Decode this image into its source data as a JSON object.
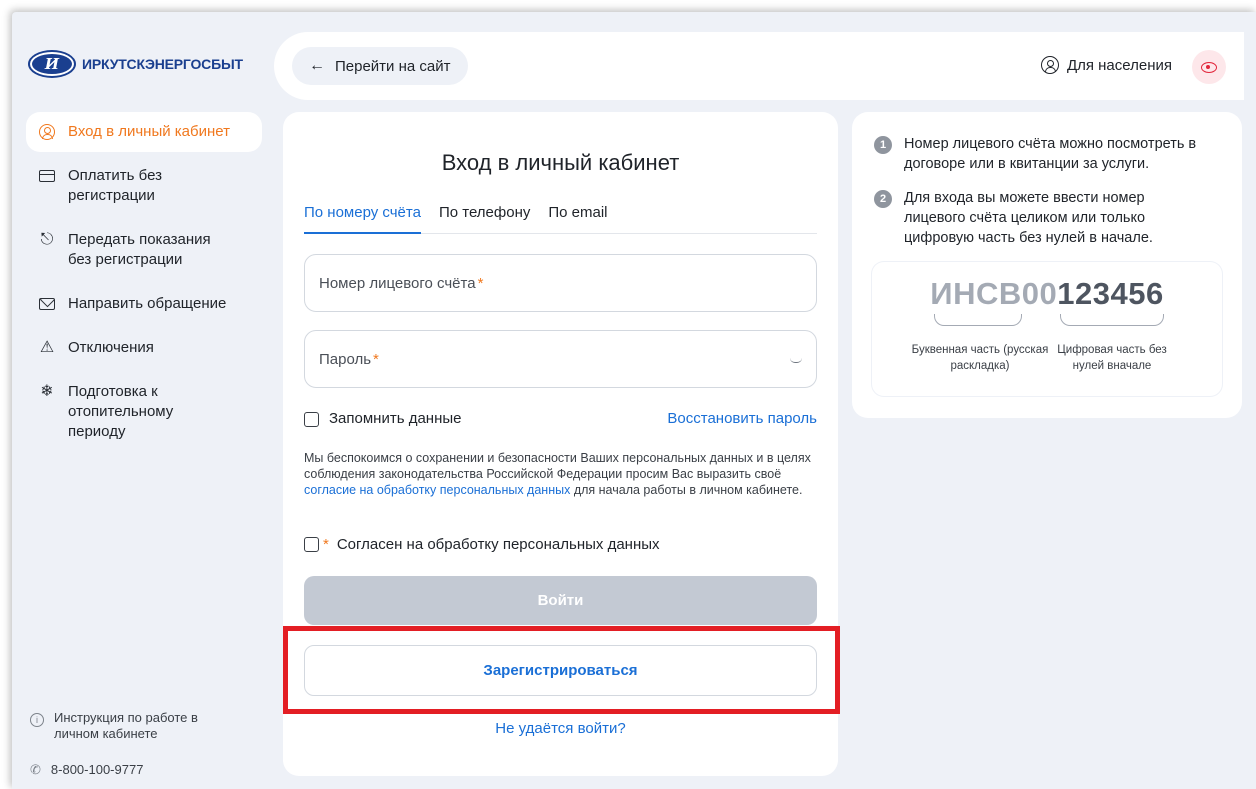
{
  "brand": {
    "logo_text": "ИРКУТСКЭНЕРГОСБЫТ",
    "logo_glyph": "И",
    "color_primary": "#1a3f8f",
    "accent": "#f0781e",
    "link": "#1a6fd6"
  },
  "topbar": {
    "back_label": "Перейти на сайт",
    "audience_label": "Для населения",
    "eye_icon": "eye-icon"
  },
  "sidebar": {
    "items": [
      {
        "label": "Вход в личный кабинет",
        "icon": "user-circle-icon",
        "active": true
      },
      {
        "label": "Оплатить без регистрации",
        "icon": "card-icon"
      },
      {
        "label": "Передать показания без регистрации",
        "icon": "meter-icon"
      },
      {
        "label": "Направить обращение",
        "icon": "mail-icon"
      },
      {
        "label": "Отключения",
        "icon": "warning-icon"
      },
      {
        "label": "Подготовка к отопительному периоду",
        "icon": "snowflake-icon"
      }
    ],
    "instructions": "Инструкция по работе в личном кабинете",
    "phone": "8-800-100-9777"
  },
  "login": {
    "title": "Вход в личный кабинет",
    "tabs": [
      "По номеру счёта",
      "По телефону",
      "По email"
    ],
    "account_placeholder": "Номер лицевого счёта",
    "password_placeholder": "Пароль",
    "required_mark": "*",
    "remember_label": "Запомнить данные",
    "restore_link": "Восстановить пароль",
    "consent_text_1": "Мы беспокоимся о сохранении и безопасности Ваших персональных данных и в целях соблюдения законодательства Российской Федерации просим Вас выразить своё",
    "consent_link": "согласие на обработку персональных данных",
    "consent_text_2": "для начала работы в личном кабинете.",
    "agree_label": "Согласен на обработку персональных данных",
    "login_button": "Войти",
    "register_button": "Зарегистрироваться",
    "cant_login_link": "Не удаётся войти?"
  },
  "info": {
    "step1_num": "1",
    "step1": "Номер лицевого счёта можно посмотреть в договоре или в квитанции за услуги.",
    "step2_num": "2",
    "step2": "Для входа вы можете ввести номер лицевого счёта целиком или только цифровую часть без нулей в начале.",
    "sample_letters": "ИНСВ",
    "sample_zeros": "00",
    "sample_digits": "123456",
    "caption_letters": "Буквенная часть (русская раскладка)",
    "caption_digits": "Цифровая часть без нулей вначале"
  }
}
